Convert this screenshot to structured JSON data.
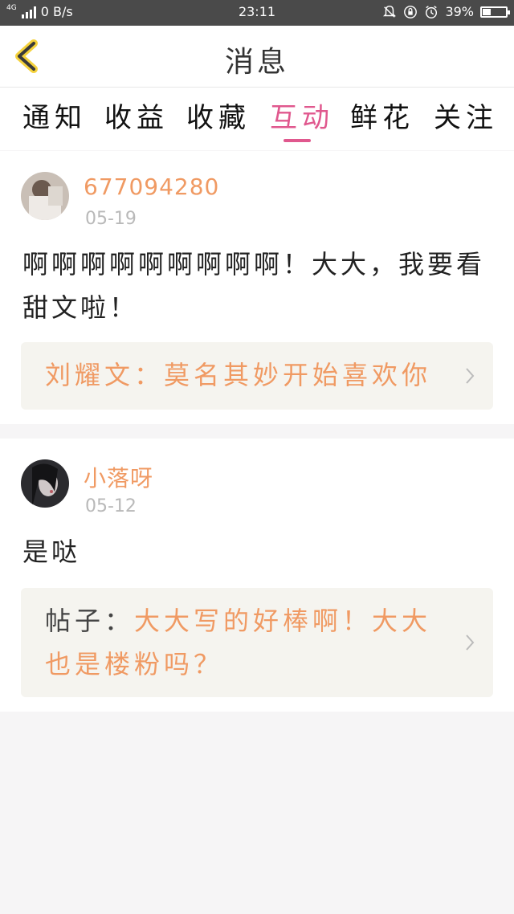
{
  "status_bar": {
    "network": "4G",
    "speed": "0 B/s",
    "time": "23:11",
    "battery": "39%",
    "battery_level": 0.39
  },
  "header": {
    "title": "消息"
  },
  "tabs": [
    {
      "label": "通知",
      "active": false
    },
    {
      "label": "收益",
      "active": false
    },
    {
      "label": "收藏",
      "active": false
    },
    {
      "label": "互动",
      "active": true
    },
    {
      "label": "鲜花",
      "active": false
    },
    {
      "label": "关注",
      "active": false
    }
  ],
  "messages": [
    {
      "username": "677094280",
      "date": "05-19",
      "content": "啊啊啊啊啊啊啊啊啊！大大，我要看甜文啦！",
      "quote_prefix": "",
      "quote_text": "刘耀文：莫名其妙开始喜欢你"
    },
    {
      "username": "小落呀",
      "date": "05-12",
      "content": "是哒",
      "quote_prefix": "帖子：",
      "quote_text": "大大写的好棒啊！大大也是楼粉吗？"
    }
  ],
  "colors": {
    "accent": "#e0588e",
    "name": "#f09a63",
    "quote_bg": "#f5f4ef"
  }
}
